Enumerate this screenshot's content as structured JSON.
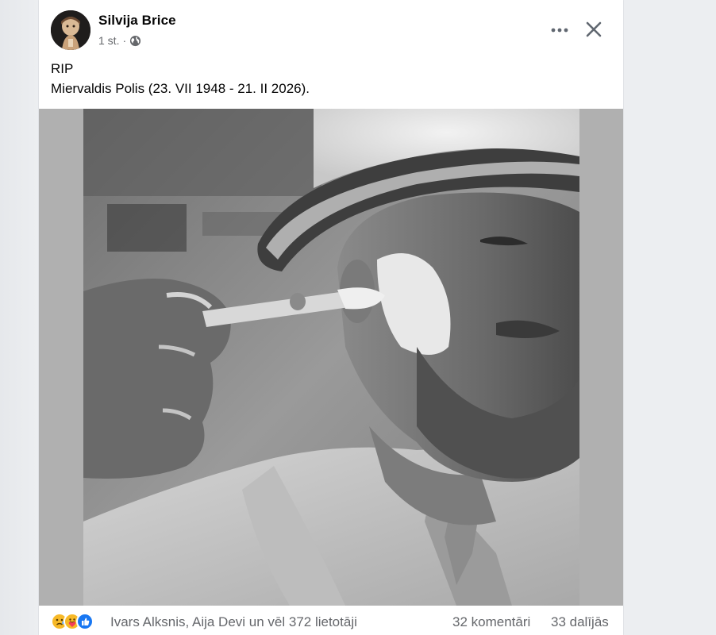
{
  "post": {
    "author": "Silvija Brice",
    "time": "1 st.",
    "separator": "·",
    "privacy_icon": "globe-icon",
    "text_line1": "RIP",
    "text_line2": "Miervaldis Polis (23. VII 1948 - 21. II 2026).",
    "photo_alt": "Black and white photo of a man in a white hat with a painted face, a hand applying paint with a brush"
  },
  "header_actions": {
    "more_icon": "more-dots-icon",
    "close_icon": "close-icon"
  },
  "footer": {
    "reaction_icons": [
      "sad-icon",
      "care-icon",
      "like-icon"
    ],
    "reactors_text": "Ivars Alksnis, Aija Devi un vēl 372 lietotāji",
    "comments_text": "32 komentāri",
    "shares_text": "33 dalījās"
  },
  "colors": {
    "text_primary": "#050505",
    "text_secondary": "#65676b",
    "like_blue": "#1877f2",
    "reaction_yellow": "#f7b928",
    "photo_bg": "#b0b0b0"
  }
}
